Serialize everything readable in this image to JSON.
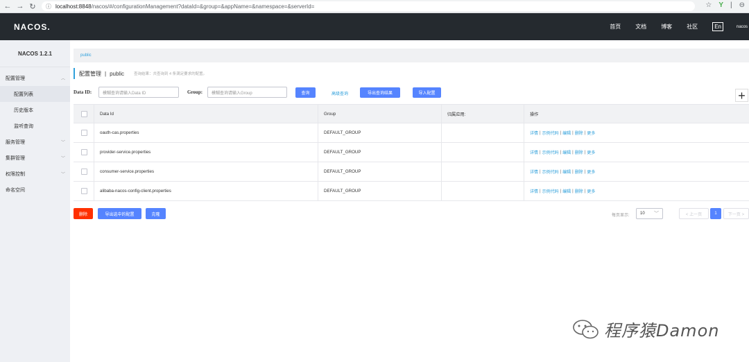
{
  "browser": {
    "url_host": "localhost:8848",
    "url_rest": "/nacos/#/configurationManagement?dataId=&group=&appName=&namespace=&serverId="
  },
  "topnav": {
    "logo": "NACOS.",
    "items": [
      "首页",
      "文档",
      "博客",
      "社区"
    ],
    "lang": "En",
    "user": "nacos"
  },
  "sidebar": {
    "version": "NACOS 1.2.1",
    "items": [
      {
        "label": "配置管理"
      },
      {
        "label": "配置列表"
      },
      {
        "label": "历史版本"
      },
      {
        "label": "监听查询"
      },
      {
        "label": "服务管理"
      },
      {
        "label": "集群管理"
      },
      {
        "label": "权限控制"
      },
      {
        "label": "命名空间"
      }
    ]
  },
  "main": {
    "namespace_tab": "public",
    "title": "配置管理",
    "title_sep": "|",
    "title_ns": "public",
    "hint": "查询结果：共查询到 4 条满足要求的配置。",
    "search": {
      "dataid_label": "Data ID:",
      "dataid_placeholder": "模糊查询请输入Data ID",
      "group_label": "Group:",
      "group_placeholder": "模糊查询请输入Group",
      "query_button": "查询",
      "advanced_link": "高级查询",
      "export_button": "导出查询结果",
      "import_button": "导入配置"
    },
    "table": {
      "headers": [
        "Data Id",
        "Group",
        "归属应用:",
        "操作"
      ],
      "rows": [
        {
          "data_id": "oauth-cas.properties",
          "group": "DEFAULT_GROUP",
          "app": ""
        },
        {
          "data_id": "provider-service.properties",
          "group": "DEFAULT_GROUP",
          "app": ""
        },
        {
          "data_id": "consumer-service.properties",
          "group": "DEFAULT_GROUP",
          "app": ""
        },
        {
          "data_id": "alibaba-nacos-config-client.properties",
          "group": "DEFAULT_GROUP",
          "app": ""
        }
      ],
      "ops": [
        "详情",
        "示例代码",
        "编辑",
        "删除",
        "更多"
      ]
    },
    "bottom": {
      "delete_button": "删除",
      "export_selected_button": "导出选中的配置",
      "clone_button": "克隆",
      "page_size_label": "每页显示:",
      "page_size_value": "10",
      "prev": "< 上一页",
      "current_page": "1",
      "next": "下一页 >"
    }
  },
  "watermark": "程序猿Damon"
}
